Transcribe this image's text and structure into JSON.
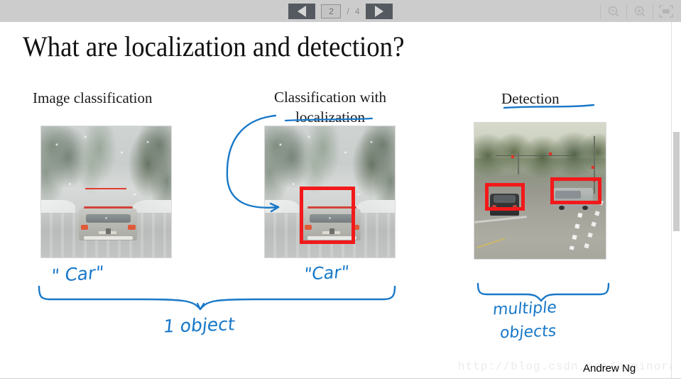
{
  "toolbar": {
    "prev_label": "Previous page",
    "next_label": "Next page",
    "current_page": "2",
    "page_separator": "/",
    "total_pages": "4",
    "zoom_out_label": "Zoom out",
    "zoom_in_label": "Zoom in",
    "fit_label": "Fit to screen"
  },
  "slide": {
    "title": "What are localization and detection?",
    "columns": [
      {
        "heading": "Image classification"
      },
      {
        "heading": "Classification with localization"
      },
      {
        "heading": "Detection"
      }
    ],
    "annotations": {
      "car_left": "\" Car\"",
      "car_middle": "\"Car\"",
      "one_object": "1 object",
      "multiple": "multiple",
      "objects": "objects"
    },
    "photos": [
      {
        "caption_alt": "Silver SUV driving on a snowy mountain road"
      },
      {
        "caption_alt": "Same snowy road photo with one red bounding box around the SUV"
      },
      {
        "caption_alt": "Road intersection with two red bounding boxes around two cars"
      }
    ]
  },
  "footer": {
    "watermark": "http://blog.csdn.net/dominoracle",
    "presenter": "Andrew Ng"
  },
  "colors": {
    "toolbar_bg": "#cccccc",
    "ink_blue": "#1878c8",
    "box_red": "#f2191a",
    "page_bg": "#ffffff"
  }
}
